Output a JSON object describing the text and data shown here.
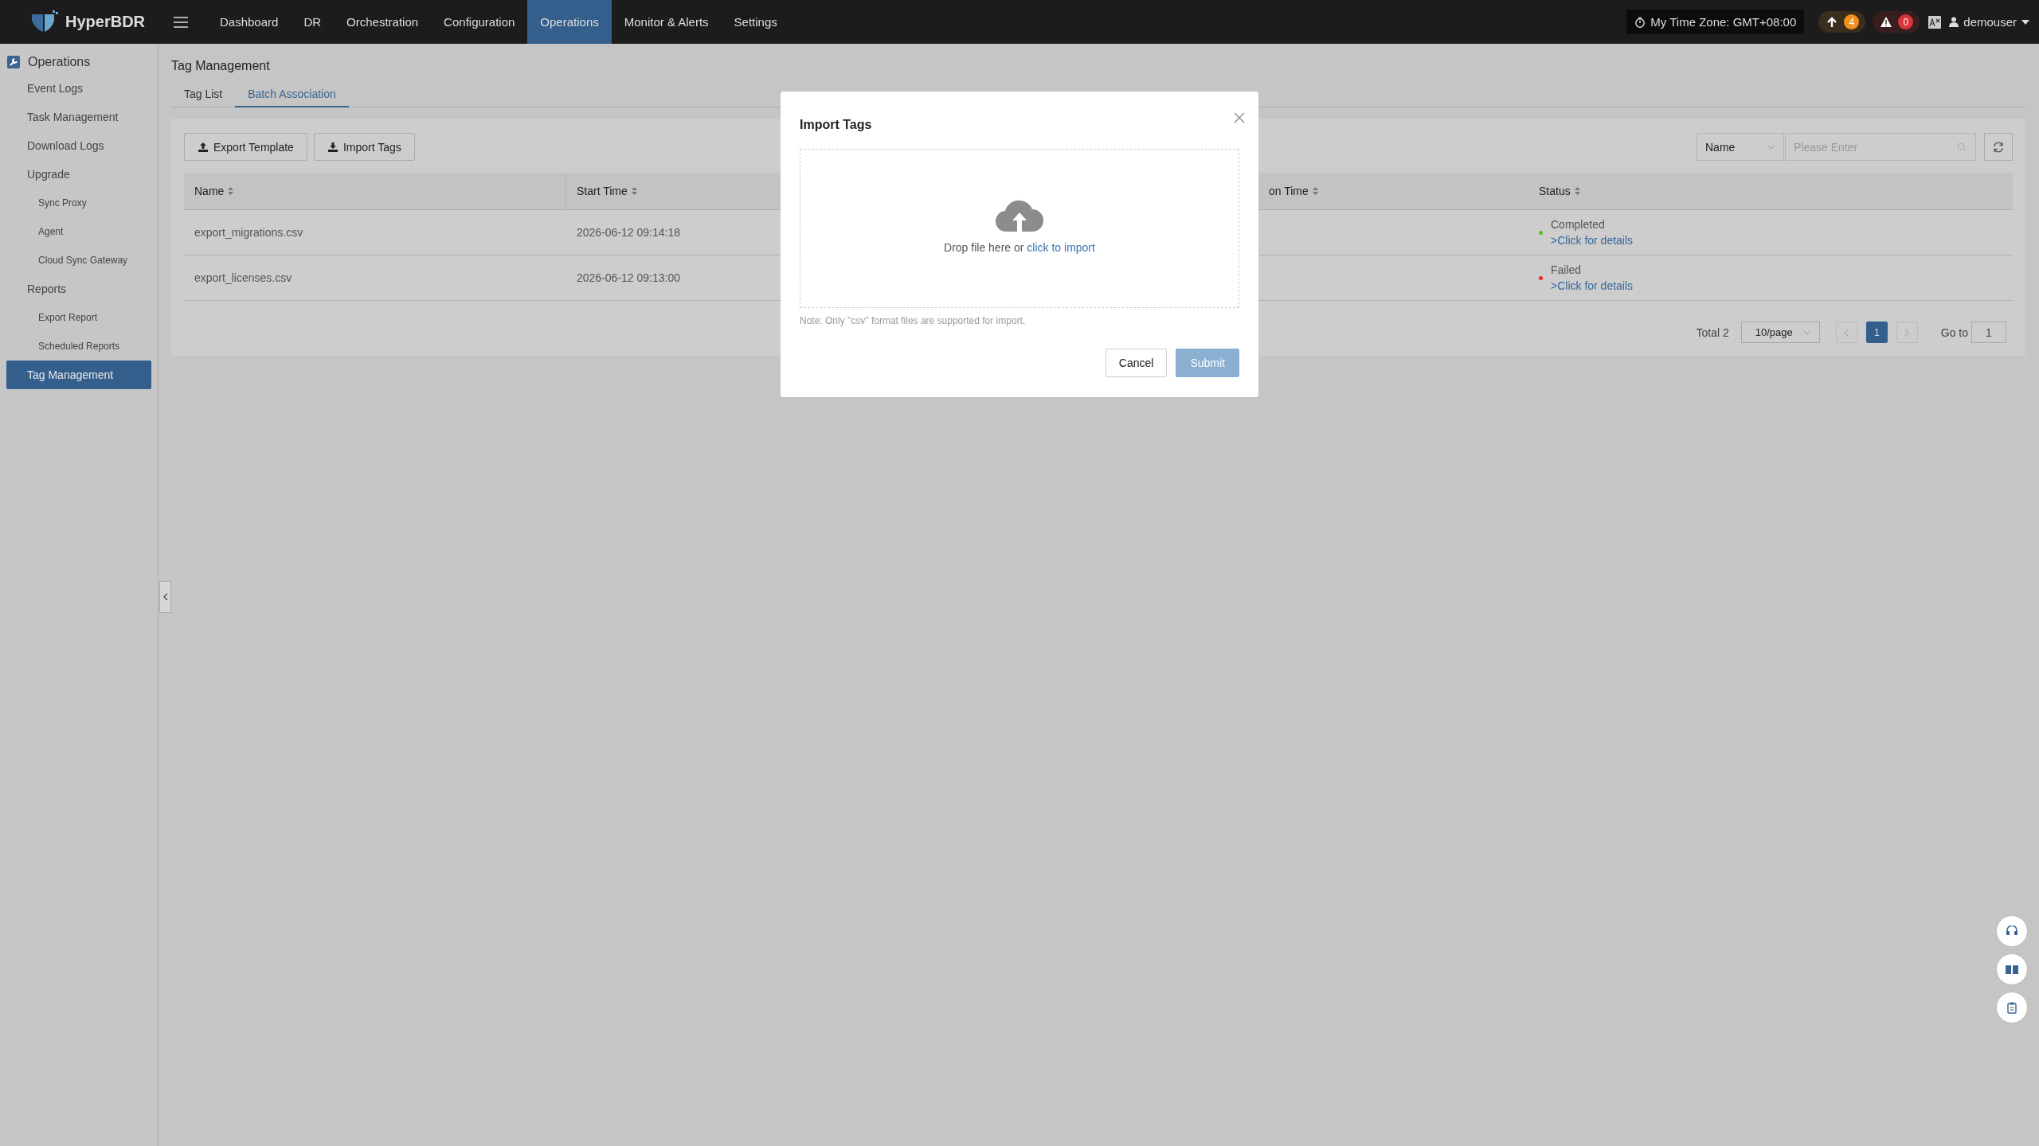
{
  "topbar": {
    "logo": "HyperBDR",
    "nav": [
      {
        "label": "Dashboard",
        "selected": false
      },
      {
        "label": "DR",
        "selected": false
      },
      {
        "label": "Orchestration",
        "selected": false
      },
      {
        "label": "Configuration",
        "selected": false
      },
      {
        "label": "Operations",
        "selected": true
      },
      {
        "label": "Monitor & Alerts",
        "selected": false
      },
      {
        "label": "Settings",
        "selected": false
      }
    ],
    "timezone": "My Time Zone: GMT+08:00",
    "upload_count": "4",
    "alert_count": "0",
    "user": "demouser"
  },
  "sidebar": {
    "section": "Operations",
    "items": [
      {
        "label": "Event Logs",
        "selected": false
      },
      {
        "label": "Task Management",
        "selected": false
      },
      {
        "label": "Download Logs",
        "selected": false
      },
      {
        "label": "Upgrade",
        "selected": false,
        "children": [
          {
            "label": "Sync Proxy",
            "selected": false
          },
          {
            "label": "Agent",
            "selected": false
          },
          {
            "label": "Cloud Sync Gateway",
            "selected": false
          }
        ]
      },
      {
        "label": "Reports",
        "selected": false,
        "children": [
          {
            "label": "Export Report",
            "selected": false
          },
          {
            "label": "Scheduled Reports",
            "selected": false
          }
        ]
      },
      {
        "label": "Tag Management",
        "selected": true
      }
    ]
  },
  "page": {
    "title": "Tag Management",
    "tabs": [
      {
        "label": "Tag List",
        "selected": false
      },
      {
        "label": "Batch Association",
        "selected": true
      }
    ],
    "toolbar": [
      "Export Template",
      "Import Tags"
    ],
    "filter": {
      "field": "Name",
      "placeholder": "Please Enter"
    },
    "columns": [
      "Name",
      "Start Time",
      "on Time",
      "Status"
    ],
    "rows": [
      {
        "name": "export_migrations.csv",
        "start_time": "2026-06-12 09:14:18",
        "status": "Completed",
        "color": "#52c41a",
        "details": ">Click for details"
      },
      {
        "name": "export_licenses.csv",
        "start_time": "2026-06-12 09:13:00",
        "status": "Failed",
        "color": "#f5222d",
        "details": ">Click for details"
      }
    ],
    "pagination": {
      "total": "Total 2",
      "page_size": "10/page",
      "pages": [
        {
          "label": "1",
          "selected": true
        }
      ],
      "goto_label": "Go to",
      "goto_value": "1"
    }
  },
  "modal": {
    "title": "Import Tags",
    "drop_text": "Drop file here or",
    "link": "click to import",
    "note": "Note: Only \"csv\" format files are supported for import.",
    "cancel": "Cancel",
    "submit": "Submit",
    "submit_disabled": true
  }
}
